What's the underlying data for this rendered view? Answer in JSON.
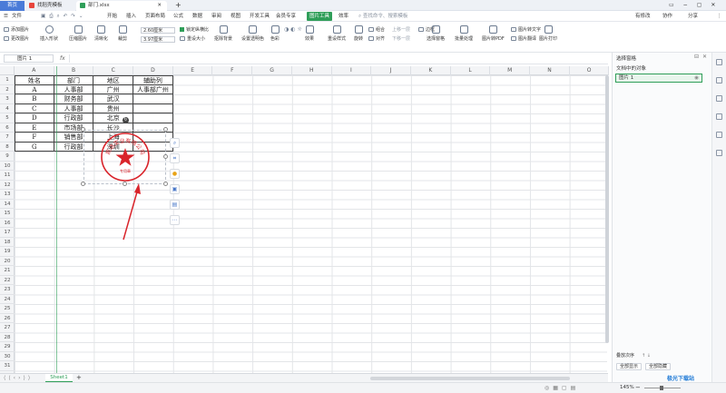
{
  "titlebar": {
    "home_tab": "首页",
    "tab1": "找稻壳模板",
    "tab2": "部门.xlsx",
    "add_tab": "+"
  },
  "menubar": {
    "file": "文件",
    "items": [
      "开始",
      "插入",
      "页面布局",
      "公式",
      "数据",
      "审阅",
      "视图",
      "开发工具",
      "会员专享",
      "图片工具",
      "效率"
    ],
    "active": "图片工具",
    "search": "查找命令、搜索模板",
    "sync": "有修改",
    "collab": "协作",
    "share": "分享"
  },
  "ribbon": {
    "add_picture": "添加图片",
    "change_picture": "更改图片",
    "insert_shape": "插入形状",
    "compress": "压缩图片",
    "sharpen": "清晰化",
    "crop": "裁剪",
    "height": "2.60厘米",
    "width": "3.97厘米",
    "lock_ratio": "锁定纵横比",
    "reset_size": "重设大小",
    "cutout": "抠除背景",
    "set_transparent": "设置透明色",
    "color": "色彩",
    "effects": "效果",
    "reset_style": "重设样式",
    "rotate": "旋转",
    "combine": "组合",
    "align": "对齐",
    "bring_forward": "上移一层",
    "send_backward": "下移一层",
    "border": "边框",
    "select_pane": "选择窗格",
    "batch": "批量处理",
    "to_pdf": "图片转PDF",
    "to_text": "图片转文字",
    "translate": "图片翻译",
    "print": "图片打印"
  },
  "formula": {
    "namebox": "图片 1",
    "fx": "fx"
  },
  "columns": [
    "A",
    "B",
    "C",
    "D",
    "E",
    "F",
    "G",
    "H",
    "I",
    "J",
    "K",
    "L",
    "M",
    "N",
    "O"
  ],
  "rows": [
    "1",
    "2",
    "3",
    "4",
    "5",
    "6",
    "7",
    "8",
    "9",
    "10",
    "11",
    "12",
    "13",
    "14",
    "15",
    "16",
    "17",
    "18",
    "19",
    "20",
    "21",
    "22",
    "23",
    "24",
    "25",
    "26",
    "27",
    "28",
    "29",
    "30",
    "31"
  ],
  "table": {
    "headers": [
      "姓名",
      "部门",
      "地区",
      "辅助列"
    ],
    "data": [
      [
        "A",
        "人事部",
        "广州",
        "人事部广州"
      ],
      [
        "B",
        "财务部",
        "武汉",
        ""
      ],
      [
        "C",
        "人事部",
        "贵州",
        ""
      ],
      [
        "D",
        "行政部",
        "北京",
        ""
      ],
      [
        "E",
        "市场部",
        "长沙",
        ""
      ],
      [
        "F",
        "销售部",
        "上海",
        ""
      ],
      [
        "G",
        "行政部",
        "深圳",
        ""
      ]
    ]
  },
  "stamp": {
    "text": "凯达实业有限公司",
    "sub": "专用章",
    "color": "#d9242b"
  },
  "sheets": {
    "active": "Sheet1",
    "add": "+"
  },
  "status": {
    "zoom": "145%",
    "zoom_minus": "−",
    "zoom_plus": "+"
  },
  "pane": {
    "title": "选择窗格",
    "section": "文档中的对象",
    "item": "图片 1",
    "order_label": "叠放次序",
    "show_all": "全部显示",
    "hide_all": "全部隐藏"
  },
  "watermark": "极光下载站"
}
